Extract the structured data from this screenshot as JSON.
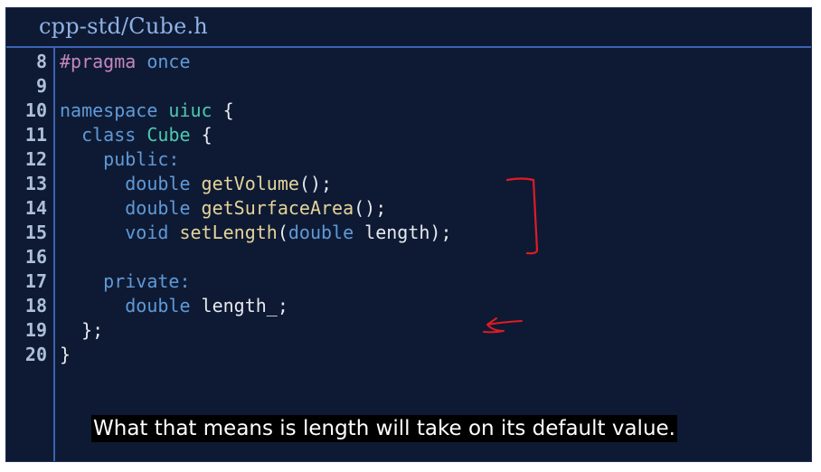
{
  "title": "cpp-std/Cube.h",
  "line_numbers": [
    "8",
    "9",
    "10",
    "11",
    "12",
    "13",
    "14",
    "15",
    "16",
    "17",
    "18",
    "19",
    "20"
  ],
  "code": {
    "l8": {
      "t1": "#pragma",
      "t2": " ",
      "t3": "once"
    },
    "l10": {
      "t1": "namespace",
      "t2": " ",
      "t3": "uiuc",
      "t4": " {"
    },
    "l11": {
      "t1": "  ",
      "t2": "class",
      "t3": " ",
      "t4": "Cube",
      "t5": " {"
    },
    "l12": {
      "t1": "    ",
      "t2": "public:"
    },
    "l13": {
      "t1": "      ",
      "t2": "double",
      "t3": " ",
      "t4": "getVolume",
      "t5": "();"
    },
    "l14": {
      "t1": "      ",
      "t2": "double",
      "t3": " ",
      "t4": "getSurfaceArea",
      "t5": "();"
    },
    "l15": {
      "t1": "      ",
      "t2": "void",
      "t3": " ",
      "t4": "setLength",
      "t5": "(",
      "t6": "double",
      "t7": " length);"
    },
    "l17": {
      "t1": "    ",
      "t2": "private:"
    },
    "l18": {
      "t1": "      ",
      "t2": "double",
      "t3": " length_;"
    },
    "l19": {
      "t1": "  };"
    },
    "l20": {
      "t1": "}"
    }
  },
  "caption": "What that means is length will take on its default value.",
  "colors": {
    "background": "#0e1a33",
    "accent": "#3a64b2",
    "keyword": "#5f9ad8",
    "function": "#e4d49a",
    "class": "#4ec9b0",
    "preprocessor": "#c586c0",
    "annotation": "#e01b24"
  },
  "annotations": [
    "red-bracket",
    "red-arrow"
  ]
}
